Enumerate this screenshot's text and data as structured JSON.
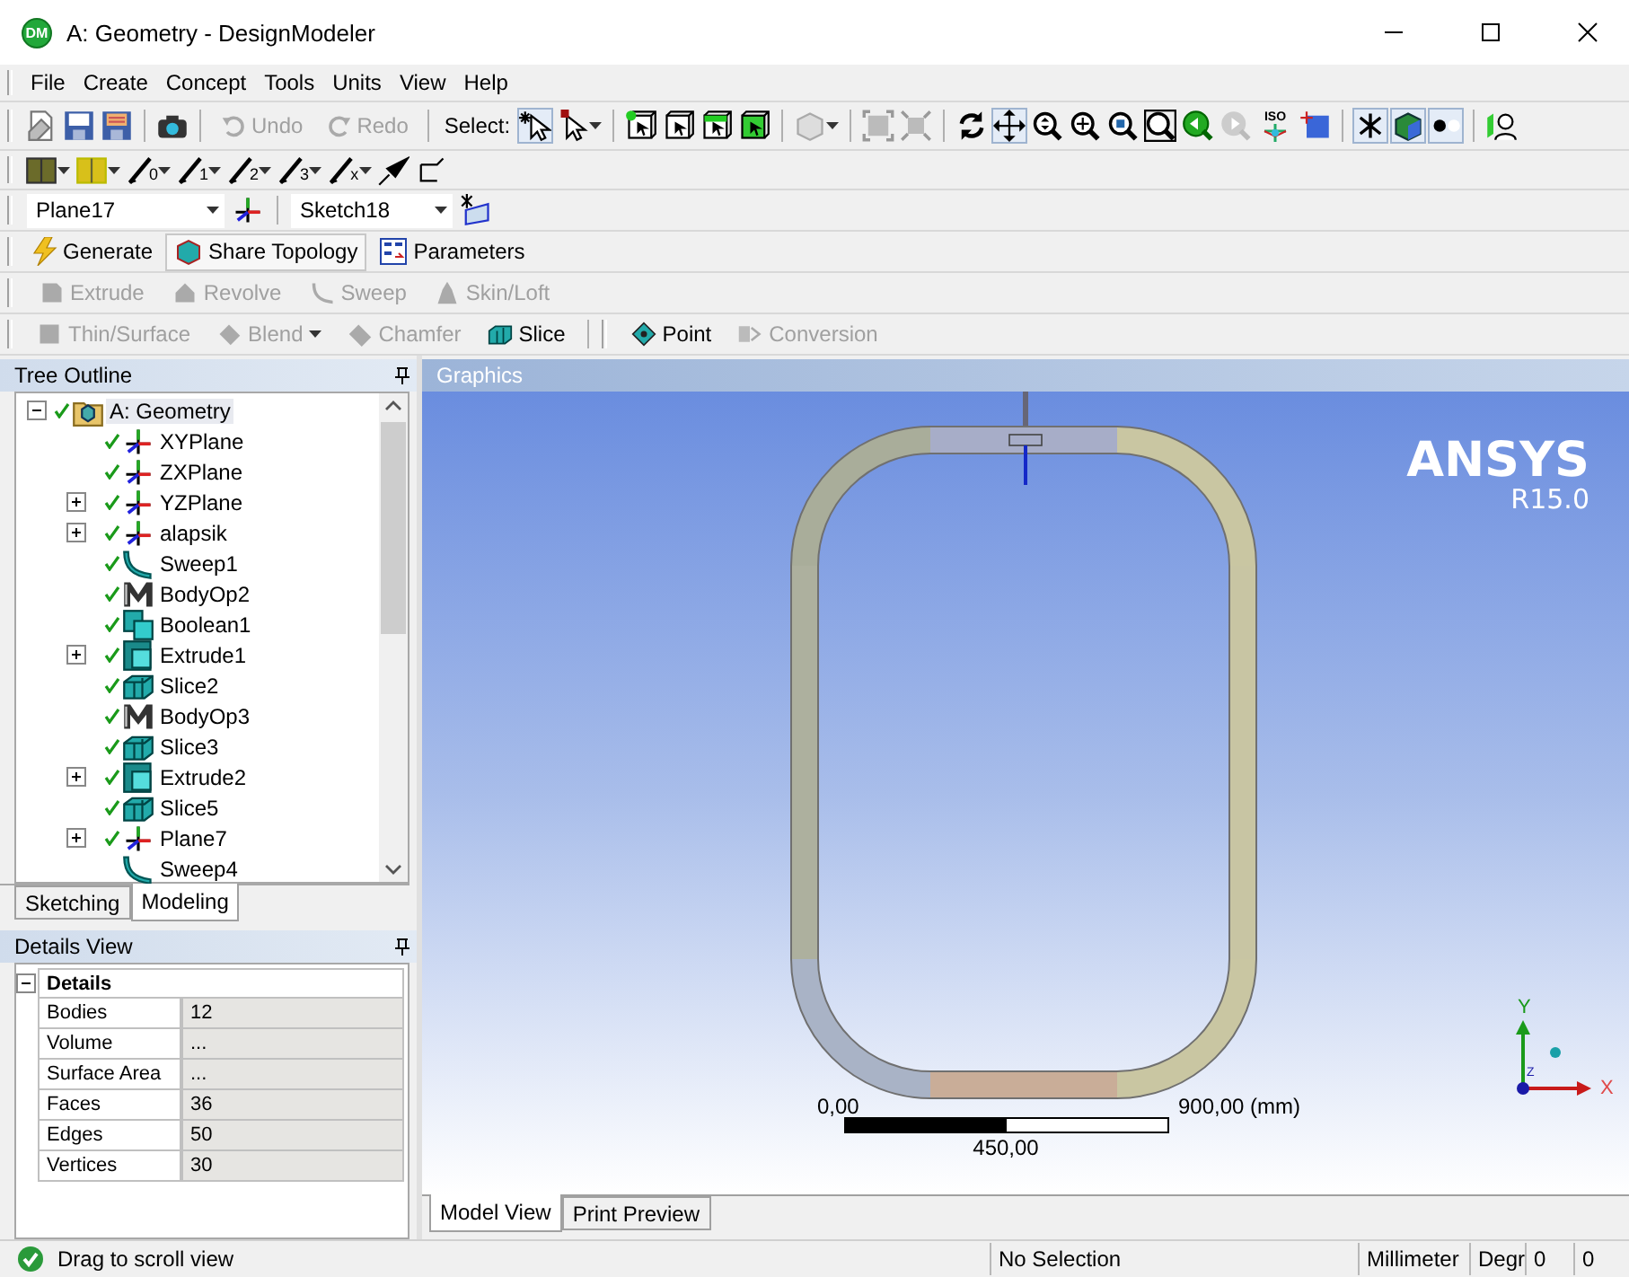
{
  "window": {
    "badge": "DM",
    "title": "A: Geometry - DesignModeler"
  },
  "menu": [
    "File",
    "Create",
    "Concept",
    "Tools",
    "Units",
    "View",
    "Help"
  ],
  "main_toolbar": {
    "undo": {
      "label": "Undo",
      "disabled": true
    },
    "redo": {
      "label": "Redo",
      "disabled": true
    },
    "select_label": "Select:",
    "iso_label": "ISO"
  },
  "edge_toolbar": {
    "subscripts": [
      "0",
      "1",
      "2",
      "3",
      "x"
    ]
  },
  "plane_bar": {
    "plane": "Plane17",
    "sketch": "Sketch18"
  },
  "feature_bar": [
    {
      "label": "Generate"
    },
    {
      "label": "Share Topology"
    },
    {
      "label": "Parameters"
    }
  ],
  "create_bar": [
    {
      "label": "Extrude",
      "disabled": true
    },
    {
      "label": "Revolve",
      "disabled": true
    },
    {
      "label": "Sweep",
      "disabled": true
    },
    {
      "label": "Skin/Loft",
      "disabled": true
    }
  ],
  "modify_bar": [
    {
      "label": "Thin/Surface",
      "disabled": true,
      "dropdown": false
    },
    {
      "label": "Blend",
      "disabled": true,
      "dropdown": true
    },
    {
      "label": "Chamfer",
      "disabled": true,
      "dropdown": false
    },
    {
      "label": "Slice",
      "disabled": false,
      "dropdown": false
    }
  ],
  "point_bar": [
    {
      "label": "Point",
      "disabled": false
    },
    {
      "label": "Conversion",
      "disabled": true
    }
  ],
  "tree_outline": {
    "title": "Tree Outline",
    "root": {
      "label": "A: Geometry",
      "kind": "geometry",
      "expanded": true,
      "valid": true,
      "selected": true,
      "children": [
        {
          "label": "XYPlane",
          "kind": "plane",
          "expandable": false,
          "valid": true,
          "selected": false
        },
        {
          "label": "ZXPlane",
          "kind": "plane",
          "expandable": false,
          "valid": true,
          "selected": false
        },
        {
          "label": "YZPlane",
          "kind": "plane",
          "expandable": true,
          "valid": true,
          "selected": false
        },
        {
          "label": "alapsik",
          "kind": "plane",
          "expandable": true,
          "valid": true,
          "selected": false
        },
        {
          "label": "Sweep1",
          "kind": "sweep",
          "expandable": false,
          "valid": true,
          "selected": false
        },
        {
          "label": "BodyOp2",
          "kind": "bodyop",
          "expandable": false,
          "valid": true,
          "selected": false
        },
        {
          "label": "Boolean1",
          "kind": "boolean",
          "expandable": false,
          "valid": true,
          "selected": false
        },
        {
          "label": "Extrude1",
          "kind": "extrude",
          "expandable": true,
          "valid": true,
          "selected": false
        },
        {
          "label": "Slice2",
          "kind": "slice",
          "expandable": false,
          "valid": true,
          "selected": false
        },
        {
          "label": "BodyOp3",
          "kind": "bodyop",
          "expandable": false,
          "valid": true,
          "selected": false
        },
        {
          "label": "Slice3",
          "kind": "slice",
          "expandable": false,
          "valid": true,
          "selected": false
        },
        {
          "label": "Extrude2",
          "kind": "extrude",
          "expandable": true,
          "valid": true,
          "selected": false
        },
        {
          "label": "Slice5",
          "kind": "slice",
          "expandable": false,
          "valid": true,
          "selected": false
        },
        {
          "label": "Plane7",
          "kind": "plane",
          "expandable": true,
          "valid": true,
          "selected": false
        },
        {
          "label": "Sweep4",
          "kind": "sweep",
          "expandable": false,
          "valid": false,
          "selected": false
        }
      ]
    }
  },
  "panel_tabs": [
    {
      "label": "Sketching",
      "selected": false
    },
    {
      "label": "Modeling",
      "selected": true
    }
  ],
  "details_view": {
    "title": "Details View",
    "group": {
      "label": "Details",
      "expanded": true,
      "rows": [
        {
          "label": "Bodies",
          "value": "12"
        },
        {
          "label": "Volume",
          "value": "..."
        },
        {
          "label": "Surface Area",
          "value": "..."
        },
        {
          "label": "Faces",
          "value": "36"
        },
        {
          "label": "Edges",
          "value": "50"
        },
        {
          "label": "Vertices",
          "value": "30"
        }
      ]
    }
  },
  "graphics": {
    "title": "Graphics",
    "logo": "ANSYS",
    "version": "R15.0",
    "scale": {
      "start": "0,00",
      "end": "900,00 (mm)",
      "middle": "450,00"
    },
    "axes": {
      "x": "X",
      "y": "Y",
      "z": "Z"
    },
    "tabs": [
      {
        "label": "Model View",
        "selected": true
      },
      {
        "label": "Print Preview",
        "selected": false
      }
    ]
  },
  "status_bar": {
    "message": "Drag to scroll view",
    "selection": "No Selection",
    "units": "Millimeter",
    "angle_units": "Degr",
    "field_1": "0",
    "field_2": "0"
  }
}
